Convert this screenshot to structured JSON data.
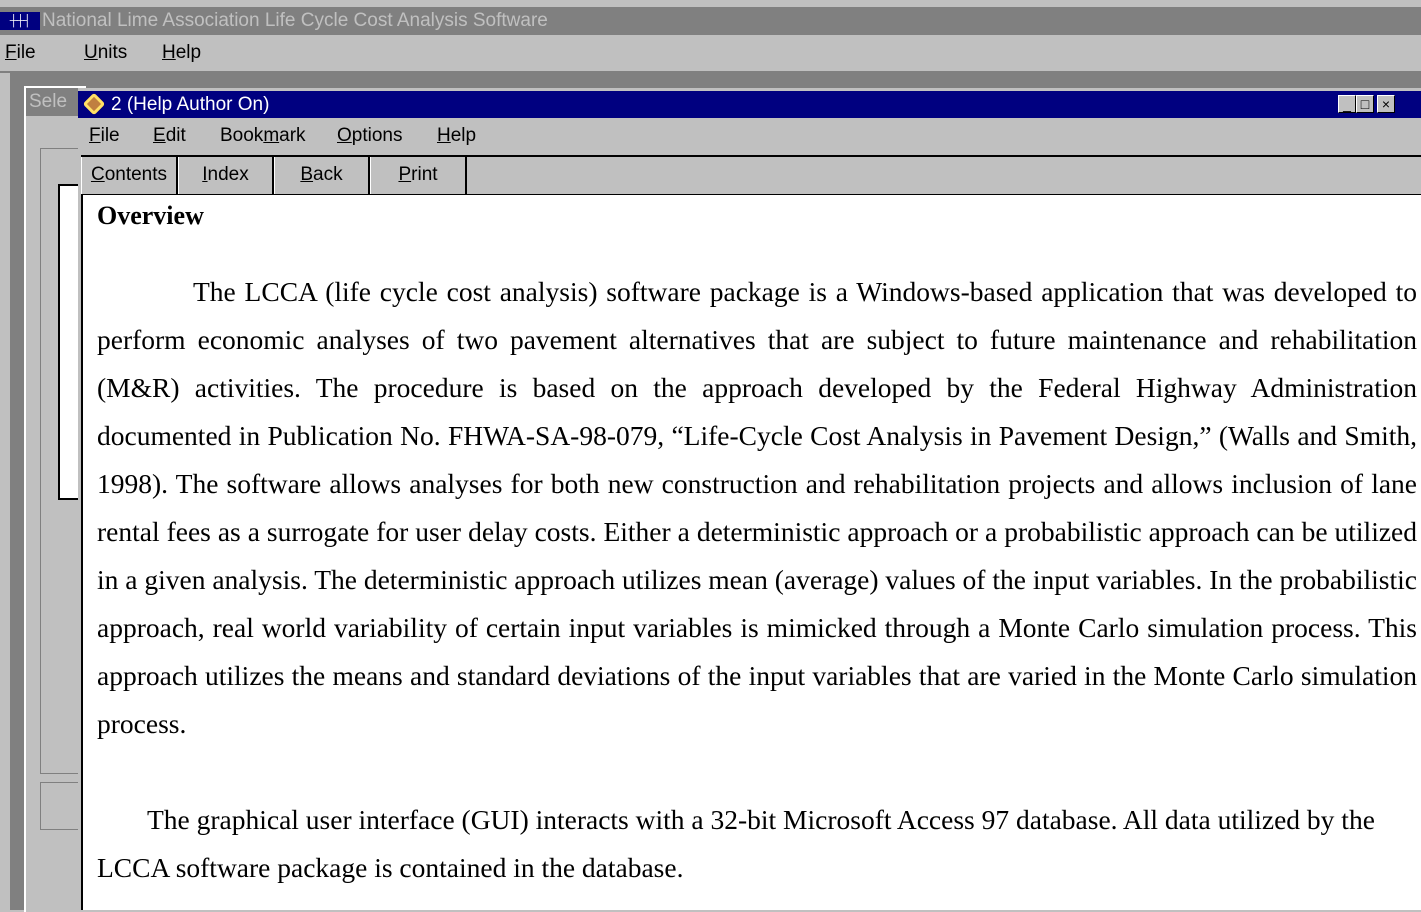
{
  "app": {
    "title": "National Lime Association Life Cycle Cost Analysis Software",
    "icon": "app-grid-icon",
    "menu": [
      {
        "label": "File",
        "key": "F",
        "rest": "ile"
      },
      {
        "label": "Units",
        "key": "U",
        "rest": "nits"
      },
      {
        "label": "Help",
        "key": "H",
        "rest": "elp"
      }
    ]
  },
  "background_window": {
    "title": "Sele"
  },
  "help_window": {
    "title": "2  (Help Author On)",
    "icon": "help-book-icon",
    "controls": {
      "minimize": "_",
      "maximize": "□",
      "close": "×"
    },
    "menu": [
      {
        "label": "File",
        "pre": "",
        "key": "F",
        "rest": "ile"
      },
      {
        "label": "Edit",
        "pre": "",
        "key": "E",
        "rest": "dit"
      },
      {
        "label": "Bookmark",
        "pre": "Book",
        "key": "m",
        "rest": "ark"
      },
      {
        "label": "Options",
        "pre": "",
        "key": "O",
        "rest": "ptions"
      },
      {
        "label": "Help",
        "pre": "",
        "key": "H",
        "rest": "elp"
      }
    ],
    "toolbar": [
      {
        "label": "Contents",
        "key": "C",
        "rest": "ontents"
      },
      {
        "label": "Index",
        "key": "I",
        "rest": "ndex"
      },
      {
        "label": "Back",
        "key": "B",
        "rest": "ack"
      },
      {
        "label": "Print",
        "key": "P",
        "rest": "rint"
      }
    ]
  },
  "content": {
    "heading": "Overview",
    "paragraphs": [
      "The LCCA (life cycle cost analysis) software package is a Windows-based application that was developed to perform economic analyses of two pavement alternatives that are subject to future maintenance and rehabilitation (M&R) activities.  The procedure is based on the approach developed by the Federal Highway Administration documented in Publication No. FHWA-SA-98-079, “Life-Cycle Cost Analysis in Pavement Design,” (Walls and Smith, 1998).  The software allows analyses for both new construction and rehabilitation projects and allows inclusion of lane rental fees as a surrogate for user delay costs.  Either a deterministic approach or a probabilistic approach can be utilized in a given analysis.  The deterministic approach utilizes mean (average) values of the input variables.  In the probabilistic approach, real world variability of certain input variables is mimicked through a Monte Carlo simulation process.  This approach utilizes the means and standard deviations of the input variables that are varied in the Monte Carlo simulation process.",
      "The graphical user interface (GUI) interacts with a 32-bit Microsoft Access 97 database.  All data utilized by the LCCA software package is contained in the database."
    ]
  },
  "colors": {
    "desktop": "#c0c0c0",
    "workspace": "#808080",
    "active_title": "#000080",
    "inactive_title": "#808080",
    "content_bg": "#ffffff"
  }
}
